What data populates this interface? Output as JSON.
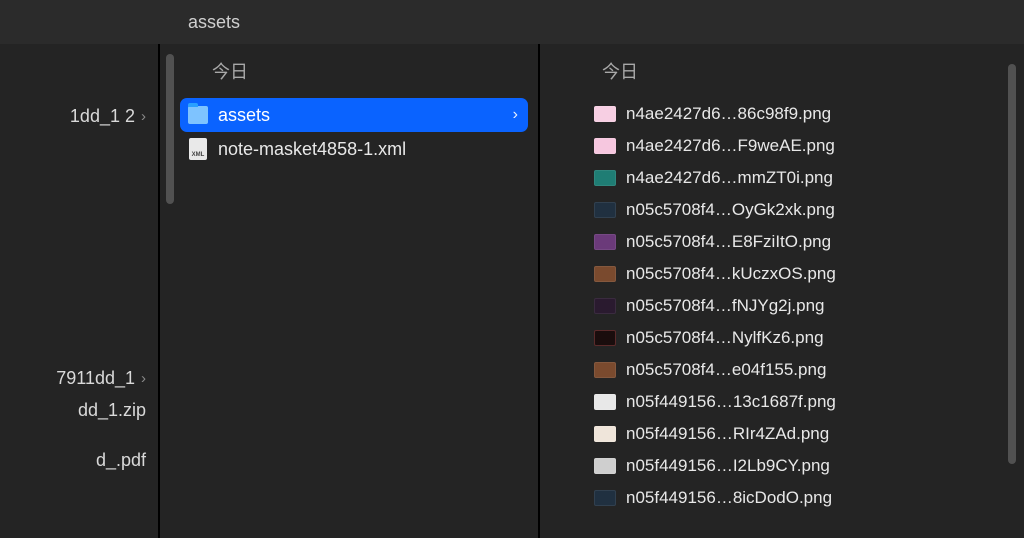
{
  "titlebar": {
    "title": "assets"
  },
  "col1": {
    "items": [
      {
        "label": "1dd_1 2",
        "hasChevron": true
      },
      {
        "label": "7911dd_1",
        "hasChevron": true
      },
      {
        "label": "dd_1.zip",
        "hasChevron": false
      },
      {
        "label": "d_.pdf",
        "hasChevron": false
      }
    ]
  },
  "col2": {
    "header": "今日",
    "items": [
      {
        "icon": "folder",
        "label": "assets",
        "selected": true,
        "hasChevron": true
      },
      {
        "icon": "xml",
        "label": "note-masket4858-1.xml",
        "selected": false,
        "hasChevron": false
      }
    ]
  },
  "col3": {
    "header": "今日",
    "items": [
      {
        "thumb": "t-pink",
        "label": "n4ae2427d6…86c98f9.png"
      },
      {
        "thumb": "t-pink2",
        "label": "n4ae2427d6…F9weAE.png"
      },
      {
        "thumb": "t-teal",
        "label": "n4ae2427d6…mmZT0i.png"
      },
      {
        "thumb": "t-dark",
        "label": "n05c5708f4…OyGk2xk.png"
      },
      {
        "thumb": "t-purple",
        "label": "n05c5708f4…E8FziItO.png"
      },
      {
        "thumb": "t-brown",
        "label": "n05c5708f4…kUczxOS.png"
      },
      {
        "thumb": "t-dark2",
        "label": "n05c5708f4…fNJYg2j.png"
      },
      {
        "thumb": "t-darkred",
        "label": "n05c5708f4…NylfKz6.png"
      },
      {
        "thumb": "t-brown2",
        "label": "n05c5708f4…e04f155.png"
      },
      {
        "thumb": "t-white",
        "label": "n05f449156…13c1687f.png"
      },
      {
        "thumb": "t-cream",
        "label": "n05f449156…RIr4ZAd.png"
      },
      {
        "thumb": "t-gray",
        "label": "n05f449156…I2Lb9CY.png"
      },
      {
        "thumb": "t-dark",
        "label": "n05f449156…8icDodO.png"
      }
    ]
  }
}
